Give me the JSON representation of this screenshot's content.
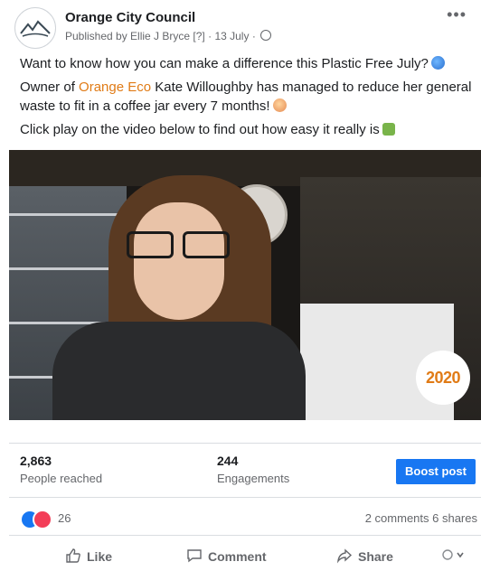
{
  "post": {
    "page_name": "Orange City Council",
    "published_by": "Published by Ellie J Bryce",
    "help_marker": "[?]",
    "date": "13 July",
    "more_icon": "more-options-icon",
    "text_line1": "Want to know how you can make a difference this Plastic Free July?",
    "text_line2_prefix": "Owner of",
    "text_line2_link": "Orange Eco",
    "text_line2_suffix": "Kate Willoughby has managed to reduce her general waste to fit in a coffee jar every 7 months!",
    "text_line3": "Click play on the video below to find out how easy it really is"
  },
  "video": {
    "badge_text": "2020"
  },
  "stats": {
    "reached_value": "2,863",
    "reached_label": "People reached",
    "engagements_value": "244",
    "engagements_label": "Engagements",
    "boost_label": "Boost post"
  },
  "reactions": {
    "count": "26",
    "comments_shares": "2 comments  6 shares"
  },
  "actions": {
    "like": "Like",
    "comment": "Comment",
    "share": "Share"
  },
  "colors": {
    "brand_blue": "#1877f2",
    "link_orange": "#e07b16",
    "meta_gray": "#65676b"
  }
}
